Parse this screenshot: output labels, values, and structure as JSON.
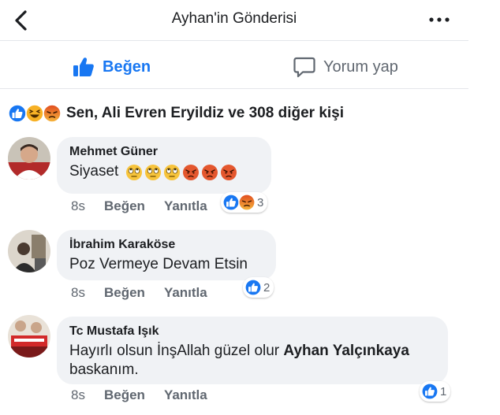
{
  "header": {
    "title": "Ayhan'in Gönderisi",
    "back_icon": "chevron-left-icon",
    "more_icon": "more-horizontal-icon"
  },
  "actions": {
    "like_label": "Beğen",
    "comment_label": "Yorum yap"
  },
  "reactions": {
    "summary": "Sen, Ali Evren Eryildiz ve 308 diğer kişi",
    "types": [
      "like",
      "haha",
      "angry"
    ]
  },
  "comments": [
    {
      "author": "Mehmet Güner",
      "text": "Siyaset",
      "emojis": [
        "rolling-eyes",
        "rolling-eyes",
        "rolling-eyes",
        "angry",
        "angry",
        "angry"
      ],
      "time": "8s",
      "like_label": "Beğen",
      "reply_label": "Yanıtla",
      "reaction_types": [
        "like",
        "angry"
      ],
      "reaction_count": "3"
    },
    {
      "author": "İbrahim Karaköse",
      "text": "Poz Vermeye Devam Etsin",
      "time": "8s",
      "like_label": "Beğen",
      "reply_label": "Yanıtla",
      "reaction_types": [
        "like"
      ],
      "reaction_count": "2"
    },
    {
      "author": "Tc Mustafa Işık",
      "text_before": "Hayırlı olsun İnşAllah güzel olur ",
      "mention": "Ayhan Yalçınkaya",
      "text_after": "baskanım.",
      "time": "8s",
      "like_label": "Beğen",
      "reply_label": "Yanıtla",
      "reaction_types": [
        "like"
      ],
      "reaction_count": "1"
    }
  ],
  "colors": {
    "accent": "#1877f2",
    "bubble": "#f0f2f5",
    "meta_text": "#606770",
    "angry": "#e9710f",
    "haha": "#f7b125"
  }
}
